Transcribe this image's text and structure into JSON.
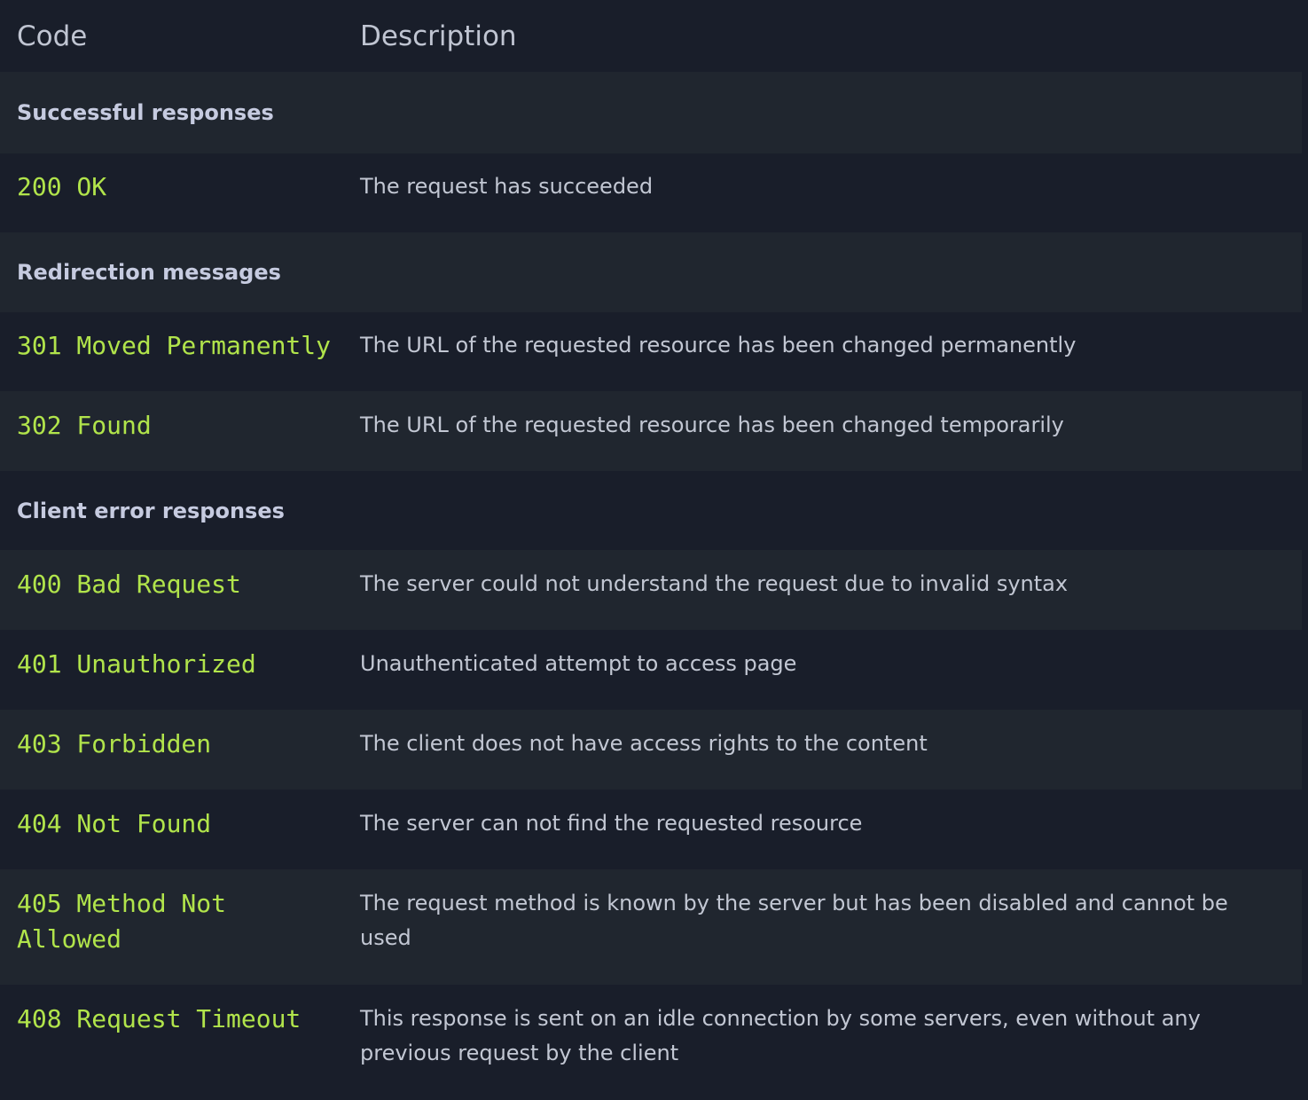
{
  "header": {
    "code": "Code",
    "description": "Description"
  },
  "groups": [
    {
      "label": "Successful responses",
      "rows": [
        {
          "code": "200 OK",
          "description": "The request has succeeded"
        }
      ]
    },
    {
      "label": "Redirection messages",
      "rows": [
        {
          "code": "301 Moved Permanently",
          "description": "The URL of the requested resource has been changed permanently"
        },
        {
          "code": "302 Found",
          "description": "The URL of the requested resource has been changed temporarily"
        }
      ]
    },
    {
      "label": "Client error responses",
      "rows": [
        {
          "code": "400 Bad Request",
          "description": "The server could not understand the request due to invalid syntax"
        },
        {
          "code": "401 Unauthorized",
          "description": "Unauthenticated attempt to access page"
        },
        {
          "code": "403 Forbidden",
          "description": "The client does not have access rights to the content"
        },
        {
          "code": "404 Not Found",
          "description": "The server can not find the requested resource"
        },
        {
          "code": "405 Method Not Allowed",
          "description": "The request method is known by the server but has been disabled and cannot be used"
        },
        {
          "code": "408 Request Timeout",
          "description": "This response is sent on an idle connection by some servers, even without any previous request by the client"
        }
      ]
    }
  ]
}
